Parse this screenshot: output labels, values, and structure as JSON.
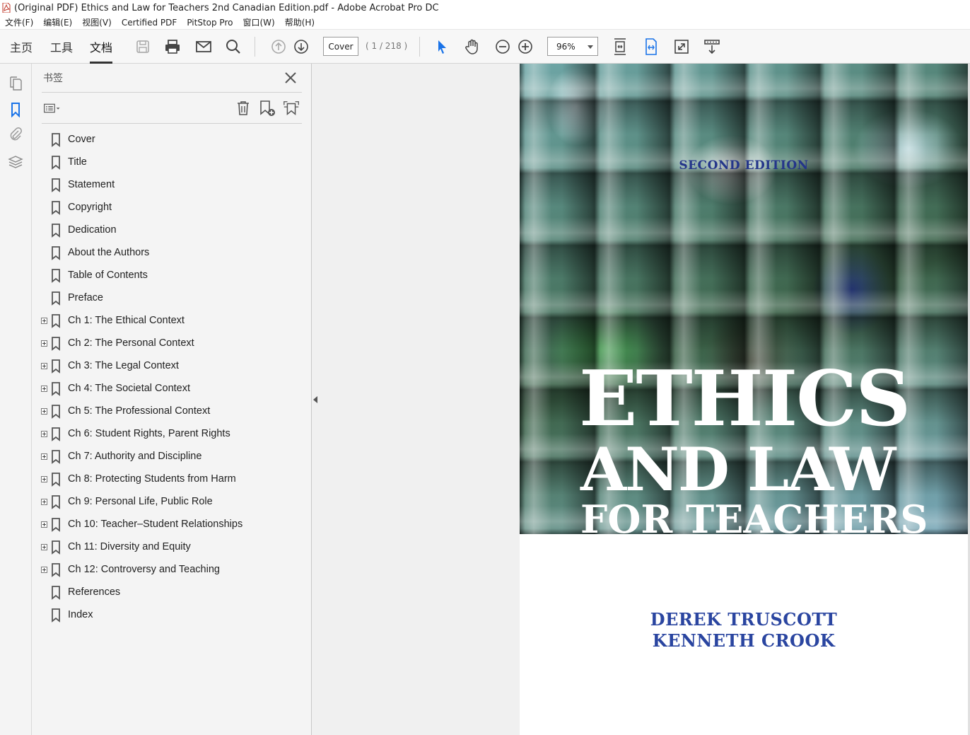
{
  "window": {
    "title": "(Original PDF) Ethics and Law for Teachers 2nd Canadian Edition.pdf - Adobe Acrobat Pro DC"
  },
  "menubar": {
    "items": [
      "文件(F)",
      "编辑(E)",
      "视图(V)",
      "Certified PDF",
      "PitStop Pro",
      "窗口(W)",
      "帮助(H)"
    ]
  },
  "toolbar": {
    "tabs": [
      "主页",
      "工具",
      "文档"
    ],
    "active_tab": "文档",
    "page_field": "Cover",
    "page_count": "( 1 / 218 )",
    "zoom": "96%"
  },
  "bookmarks_panel": {
    "title": "书签",
    "items": [
      {
        "label": "Cover",
        "expandable": false
      },
      {
        "label": "Title",
        "expandable": false
      },
      {
        "label": "Statement",
        "expandable": false
      },
      {
        "label": "Copyright",
        "expandable": false
      },
      {
        "label": "Dedication",
        "expandable": false
      },
      {
        "label": "About the Authors",
        "expandable": false
      },
      {
        "label": "Table of Contents",
        "expandable": false
      },
      {
        "label": "Preface",
        "expandable": false
      },
      {
        "label": "Ch 1: The Ethical Context",
        "expandable": true
      },
      {
        "label": "Ch 2: The Personal Context",
        "expandable": true
      },
      {
        "label": "Ch 3: The Legal Context",
        "expandable": true
      },
      {
        "label": "Ch 4: The Societal Context",
        "expandable": true
      },
      {
        "label": "Ch 5: The Professional Context",
        "expandable": true
      },
      {
        "label": "Ch 6: Student Rights, Parent Rights",
        "expandable": true
      },
      {
        "label": "Ch 7: Authority and Discipline",
        "expandable": true
      },
      {
        "label": "Ch 8: Protecting Students from Harm",
        "expandable": true
      },
      {
        "label": "Ch 9: Personal Life, Public Role",
        "expandable": true
      },
      {
        "label": "Ch 10: Teacher–Student Relationships",
        "expandable": true
      },
      {
        "label": "Ch 11: Diversity and Equity",
        "expandable": true
      },
      {
        "label": "Ch 12: Controversy and Teaching",
        "expandable": true
      },
      {
        "label": "References",
        "expandable": false
      },
      {
        "label": "Index",
        "expandable": false
      }
    ]
  },
  "cover": {
    "edition": "SECOND EDITION",
    "title_line1": "ETHICS",
    "title_line2": "AND LAW",
    "title_line3": "FOR TEACHERS",
    "author1": "DEREK TRUSCOTT",
    "author2": "KENNETH CROOK"
  },
  "colors": {
    "accent_blue": "#2a45a0",
    "edition_blue": "#24358a",
    "panel_bg": "#f4f4f4",
    "toolbar_bg": "#f7f7f7",
    "select_tool_blue": "#1a73e8"
  },
  "icons": {
    "rail": [
      "pages-icon",
      "bookmark-icon",
      "attachment-icon",
      "layers-icon"
    ],
    "toolbar": [
      "save-icon",
      "print-icon",
      "email-icon",
      "search-icon",
      "prev-page-icon",
      "next-page-icon",
      "select-arrow-icon",
      "hand-icon",
      "zoom-out-icon",
      "zoom-in-icon",
      "fit-page-icon",
      "fit-width-icon",
      "fullscreen-icon",
      "read-mode-icon"
    ],
    "bookmarks": [
      "options-menu-icon",
      "delete-icon",
      "new-bookmark-icon",
      "bookmark-from-structure-icon",
      "close-icon"
    ]
  }
}
